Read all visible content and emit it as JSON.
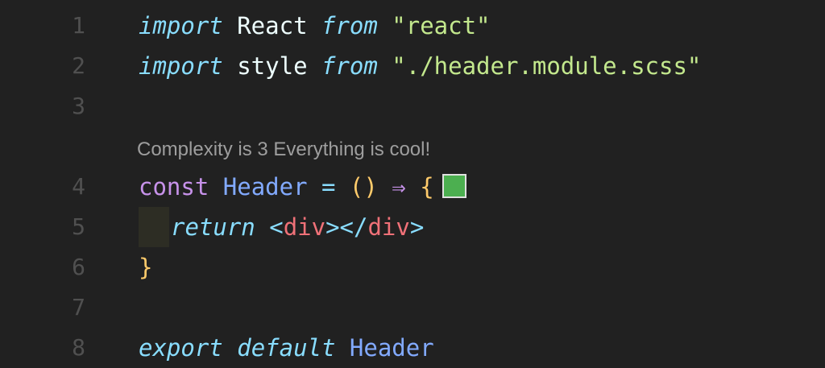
{
  "editor": {
    "codelens": "Complexity is 3 Everything is cool!",
    "swatch_color": "#4caf50",
    "lines": [
      {
        "number": "1",
        "tokens": [
          "import",
          " React ",
          "from",
          " \"react\""
        ]
      },
      {
        "number": "2",
        "tokens": [
          "import",
          " style ",
          "from",
          " \"./header.module.scss\""
        ]
      },
      {
        "number": "3",
        "tokens": []
      },
      {
        "number": "4",
        "tokens": [
          "const",
          " Header",
          " = ",
          "()",
          " ⇒ ",
          "{"
        ]
      },
      {
        "number": "5",
        "tokens": [
          "return",
          " <",
          "div",
          "></",
          "div",
          ">"
        ]
      },
      {
        "number": "6",
        "tokens": [
          "}"
        ]
      },
      {
        "number": "7",
        "tokens": []
      },
      {
        "number": "8",
        "tokens": [
          "export",
          " ",
          "default",
          " Header"
        ]
      }
    ]
  }
}
